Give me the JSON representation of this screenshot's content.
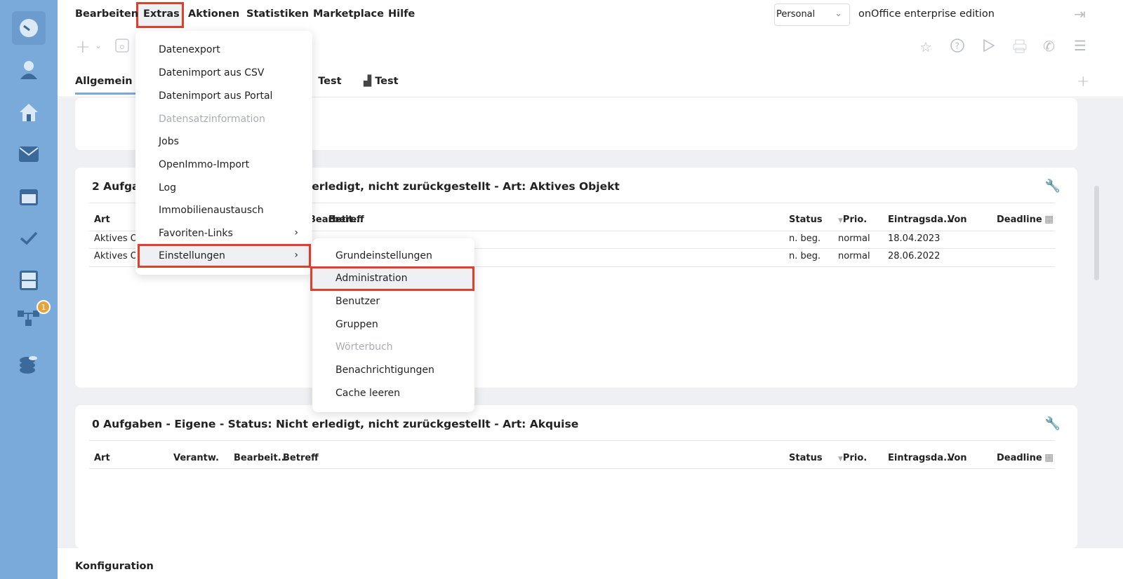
{
  "menubar": {
    "items": [
      "Bearbeiten",
      "Extras",
      "Aktionen",
      "Statistiken",
      "Marketplace",
      "Hilfe"
    ],
    "active": "Extras"
  },
  "header": {
    "profile_select": "Personal",
    "edition": "onOffice enterprise edition"
  },
  "toolbar": {
    "icons": [
      "plus-icon",
      "save-icon",
      "star-icon",
      "help-icon",
      "play-icon",
      "print-icon",
      "phone-icon",
      "menu-icon",
      "logout-icon"
    ]
  },
  "tabs": [
    {
      "label": "Allgemein",
      "active": true
    },
    {
      "label": "Test"
    },
    {
      "label": "Test"
    }
  ],
  "sidebar": {
    "icons": [
      "dashboard-icon",
      "user-icon",
      "home-icon",
      "mail-icon",
      "calendar-icon",
      "check-icon",
      "cabinet-icon",
      "workflow-icon",
      "database-icon"
    ],
    "badge": "1"
  },
  "cards": [
    {
      "title": "2 Aufgaben - Eigene - Status: Nicht erledigt, nicht zurückgestellt - Art: Aktives Objekt",
      "headers": {
        "art": "Art",
        "bearbeit": "Bearbeit...",
        "betreff": "Betreff",
        "status": "Status",
        "prio": "Prio.",
        "eintrag": "Eintragsda...",
        "von": "Von",
        "deadline": "Deadline"
      },
      "rows": [
        {
          "art": "Aktives Objekt",
          "status": "n. beg.",
          "prio": "normal",
          "date": "18.04.2023"
        },
        {
          "art": "Aktives Objekt",
          "status": "n. beg.",
          "prio": "normal",
          "date": "28.06.2022"
        }
      ]
    },
    {
      "title": "0 Aufgaben - Eigene - Status: Nicht erledigt, nicht zurückgestellt - Art: Akquise",
      "headers": {
        "art": "Art",
        "verantw": "Verantw.",
        "bearbeit": "Bearbeit...",
        "betreff": "Betreff",
        "status": "Status",
        "prio": "Prio.",
        "eintrag": "Eintragsda...",
        "von": "Von",
        "deadline": "Deadline"
      }
    }
  ],
  "extras_menu": [
    {
      "label": "Datenexport"
    },
    {
      "label": "Datenimport aus CSV"
    },
    {
      "label": "Datenimport aus Portal"
    },
    {
      "label": "Datensatzinformation",
      "disabled": true
    },
    {
      "label": "Jobs"
    },
    {
      "label": "OpenImmo-Import"
    },
    {
      "label": "Log"
    },
    {
      "label": "Immobilienaustausch"
    },
    {
      "label": "Favoriten-Links",
      "submenu": true
    },
    {
      "label": "Einstellungen",
      "submenu": true,
      "highlighted": true
    }
  ],
  "settings_menu": [
    {
      "label": "Grundeinstellungen"
    },
    {
      "label": "Administration",
      "highlighted": true
    },
    {
      "label": "Benutzer"
    },
    {
      "label": "Gruppen"
    },
    {
      "label": "Wörterbuch",
      "disabled": true
    },
    {
      "label": "Benachrichtigungen"
    },
    {
      "label": "Cache leeren"
    }
  ],
  "footer": {
    "label": "Konfiguration"
  },
  "colors": {
    "sidebar": "#7aaad9",
    "highlight_border": "#e0402a",
    "badge": "#e8a23a",
    "tab_underline": "#7aaad9"
  }
}
